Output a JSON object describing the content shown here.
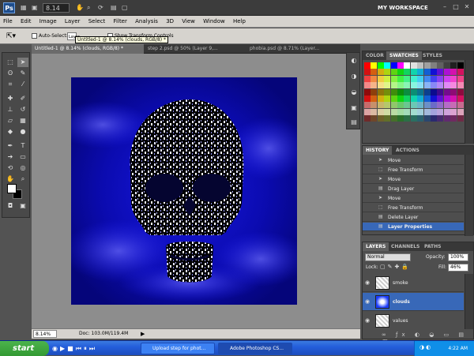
{
  "titlebar": {
    "app_logo": "Ps",
    "zoom_value": "8.14",
    "workspace": "MY WORKSPACE",
    "win_min": "–",
    "win_max": "□",
    "win_close": "✕"
  },
  "menubar": {
    "items": [
      "File",
      "Edit",
      "Image",
      "Layer",
      "Select",
      "Filter",
      "Analysis",
      "3D",
      "View",
      "Window",
      "Help"
    ]
  },
  "options": {
    "auto_select_label": "Auto-Select:",
    "auto_select_value": "Layer",
    "show_transform_label": "Show Transform Controls"
  },
  "tooltip": {
    "text": "Untitled-1 @ 8.14% (clouds, RGB/8) *"
  },
  "tabs": [
    {
      "label": "Untitled-1 @ 8.14% (clouds, RGB/8) *"
    },
    {
      "label": "step 2.psd @ 50% (Layer 9,..."
    },
    {
      "label": "phobia.psd @ 8.71% (Layer..."
    }
  ],
  "status": {
    "zoom": "8.14%",
    "doc": "Doc: 103.0M/119.4M"
  },
  "color_panel": {
    "tabs": [
      "COLOR",
      "SWATCHES",
      "STYLES"
    ],
    "active_tab": "SWATCHES"
  },
  "history_panel": {
    "tabs": [
      "HISTORY",
      "ACTIONS"
    ],
    "rows": [
      {
        "label": "Move"
      },
      {
        "label": "Free Transform"
      },
      {
        "label": "Move"
      },
      {
        "label": "Drag Layer"
      },
      {
        "label": "Move"
      },
      {
        "label": "Free Transform"
      },
      {
        "label": "Delete Layer"
      },
      {
        "label": "Layer Properties"
      }
    ]
  },
  "layers_panel": {
    "tabs": [
      "LAYERS",
      "CHANNELS",
      "PATHS"
    ],
    "blend_mode": "Normal",
    "opacity_label": "Opacity:",
    "opacity_value": "100%",
    "lock_label": "Lock:",
    "fill_label": "Fill:",
    "fill_value": "46%",
    "layers": [
      {
        "name": "smoke"
      },
      {
        "name": "clouds"
      },
      {
        "name": "values"
      }
    ]
  },
  "taskbar": {
    "start_label": "start",
    "buttons": [
      {
        "label": "Upload step for phot..."
      },
      {
        "label": "Adobe Photoshop CS..."
      }
    ],
    "clock": "4:22 AM"
  }
}
